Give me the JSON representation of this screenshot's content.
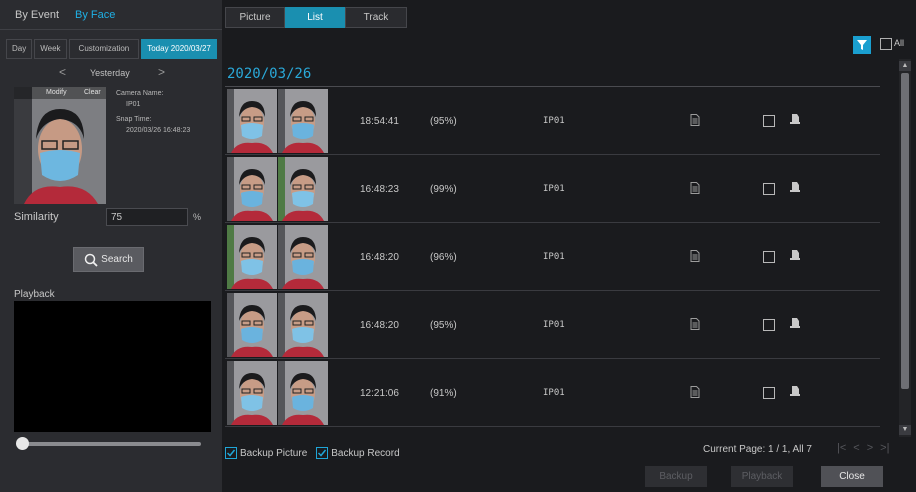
{
  "left": {
    "tabs": [
      {
        "label": "By Event",
        "active": false
      },
      {
        "label": "By Face",
        "active": true
      }
    ],
    "range": [
      {
        "label": "Day",
        "active": false
      },
      {
        "label": "Week",
        "active": false
      },
      {
        "label": "Customization",
        "active": false
      },
      {
        "label": "Today 2020/03/27",
        "active": true
      }
    ],
    "day_nav": {
      "prev": "<",
      "label": "Yesterday",
      "next": ">"
    },
    "snapshot": {
      "modify_label": "Modify",
      "clear_label": "Clear",
      "camera_name_label": "Camera Name:",
      "camera_name": "IP01",
      "snap_time_label": "Snap Time:",
      "snap_time": "2020/03/26 16:48:23"
    },
    "similarity": {
      "label": "Similarity",
      "value": "75",
      "unit": "%"
    },
    "search_label": "Search",
    "playback_label": "Playback",
    "slider_value": 0
  },
  "view_tabs": [
    {
      "label": "Picture",
      "active": false
    },
    {
      "label": "List",
      "active": true
    },
    {
      "label": "Track",
      "active": false
    }
  ],
  "filter": {
    "icon": "filter-icon",
    "all_label": "All",
    "all_checked": false
  },
  "list": {
    "date": "2020/03/26",
    "rows": [
      {
        "time": "18:54:41",
        "similarity": "(95%)",
        "camera": "IP01",
        "checked": false
      },
      {
        "time": "16:48:23",
        "similarity": "(99%)",
        "camera": "IP01",
        "checked": false
      },
      {
        "time": "16:48:20",
        "similarity": "(96%)",
        "camera": "IP01",
        "checked": false
      },
      {
        "time": "16:48:20",
        "similarity": "(95%)",
        "camera": "IP01",
        "checked": false
      },
      {
        "time": "12:21:06",
        "similarity": "(91%)",
        "camera": "IP01",
        "checked": false
      }
    ]
  },
  "bottom": {
    "backup_picture": {
      "label": "Backup Picture",
      "checked": true
    },
    "backup_record": {
      "label": "Backup Record",
      "checked": true
    },
    "page_info": "Current Page: 1 / 1, All 7",
    "pager": [
      "|<",
      "<",
      ">",
      ">|"
    ],
    "buttons": {
      "backup": "Backup",
      "playback": "Playback",
      "close": "Close"
    }
  },
  "colors": {
    "accent": "#1a8fb0",
    "date_blue": "#2aa8d8",
    "panel": "#2b2c30",
    "background": "#1a1b1e"
  }
}
